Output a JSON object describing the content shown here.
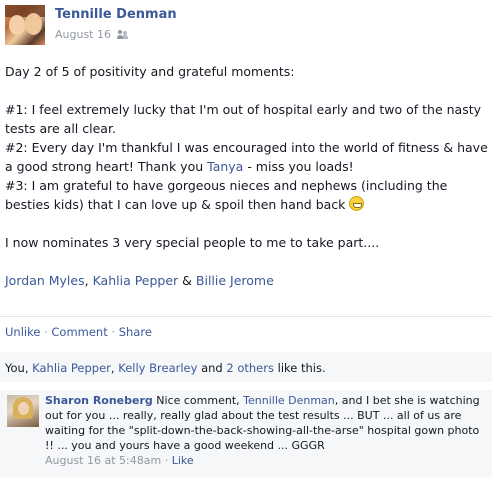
{
  "post": {
    "author": "Tennille Denman",
    "date": "August 16",
    "audience_icon": "friends-icon",
    "line1": "Day 2 of 5 of positivity and grateful moments:",
    "item1": "#1: I feel extremely lucky that I'm out of hospital early and two of the nasty tests are all clear.",
    "item2_pre": "#2: Every day I'm thankful I was encouraged into the world of fitness & have a good strong heart! Thank you ",
    "item2_link": "Tanya",
    "item2_post": " - miss you loads!",
    "item3": "#3: I am grateful to have gorgeous nieces and nephews (including the besties kids) that I can love up & spoil then hand back ",
    "emoji": "grin-emoji",
    "nominate": "I now nominates 3 very special people to me to take part....",
    "nominees": [
      "Jordan Myles",
      "Kahlia Pepper",
      "Billie Jerome"
    ],
    "comma": ", ",
    "amp": " & "
  },
  "actions": {
    "unlike": "Unlike",
    "sep": " · ",
    "comment": "Comment",
    "share": "Share"
  },
  "likes": {
    "prefix": "You, ",
    "name1": "Kahlia Pepper",
    "comma": ", ",
    "name2": "Kelly Brearley",
    "and": " and ",
    "others": "2 others",
    "suffix": " like this."
  },
  "comment": {
    "author": "Sharon Roneberg",
    "text_pre": " Nice comment, ",
    "mention": "Tennille Denman",
    "text_post": ", and I bet she is watching out for you ... really, really glad about the test results ... BUT ... all of us are waiting for the \"split-down-the-back-showing-all-the-arse\" hospital gown photo !! ... you and yours have a good weekend ... GGGR",
    "timestamp": "August 16 at 5:48am",
    "sep": " · ",
    "like": "Like"
  },
  "colors": {
    "link": "#3b5998",
    "meta": "#9197a3",
    "text": "#141823",
    "panel": "#f6f7f8"
  }
}
